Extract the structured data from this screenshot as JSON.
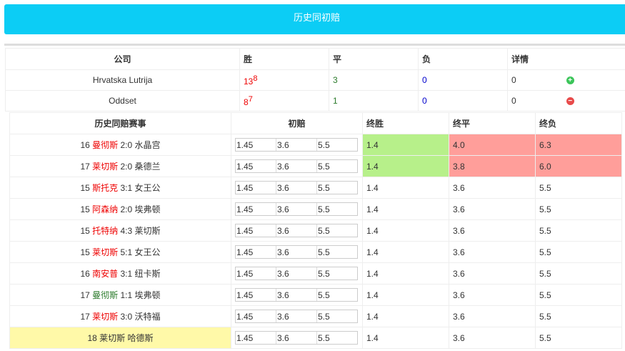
{
  "title": "历史同初赔",
  "companies": {
    "headers": [
      "公司",
      "胜",
      "平",
      "负",
      "详情"
    ],
    "rows": [
      {
        "name": "Hrvatska Lutrija",
        "win": "13",
        "win_sup": "8",
        "draw": "3",
        "loss": "0",
        "detail": "0",
        "icon": "plus-circle-icon",
        "icon_color": "#3cc55a"
      },
      {
        "name": "Oddset",
        "win": "8",
        "win_sup": "7",
        "draw": "1",
        "loss": "0",
        "detail": "0",
        "icon": "minus-circle-icon",
        "icon_color": "#e84a4a"
      }
    ]
  },
  "history": {
    "headers": [
      "历史同赔赛事",
      "初赔",
      "终胜",
      "终平",
      "终负"
    ],
    "rows": [
      {
        "season": "16",
        "home": "曼彻斯",
        "home_color": "red",
        "score": "2:0",
        "away": "水晶宫",
        "init": [
          "1.45",
          "3.6",
          "5.5"
        ],
        "final": [
          "1.4",
          "4.0",
          "6.3"
        ],
        "hl": [
          "g",
          "r",
          "r"
        ]
      },
      {
        "season": "17",
        "home": "莱切斯",
        "home_color": "red",
        "score": "2:0",
        "away": "桑德兰",
        "init": [
          "1.45",
          "3.6",
          "5.5"
        ],
        "final": [
          "1.4",
          "3.8",
          "6.0"
        ],
        "hl": [
          "g",
          "r",
          "r"
        ]
      },
      {
        "season": "15",
        "home": "斯托克",
        "home_color": "red",
        "score": "3:1",
        "away": "女王公",
        "init": [
          "1.45",
          "3.6",
          "5.5"
        ],
        "final": [
          "1.4",
          "3.6",
          "5.5"
        ],
        "hl": [
          "",
          "",
          ""
        ]
      },
      {
        "season": "15",
        "home": "阿森纳",
        "home_color": "red",
        "score": "2:0",
        "away": "埃弗顿",
        "init": [
          "1.45",
          "3.6",
          "5.5"
        ],
        "final": [
          "1.4",
          "3.6",
          "5.5"
        ],
        "hl": [
          "",
          "",
          ""
        ]
      },
      {
        "season": "15",
        "home": "托特纳",
        "home_color": "red",
        "score": "4:3",
        "away": "莱切斯",
        "init": [
          "1.45",
          "3.6",
          "5.5"
        ],
        "final": [
          "1.4",
          "3.6",
          "5.5"
        ],
        "hl": [
          "",
          "",
          ""
        ]
      },
      {
        "season": "15",
        "home": "莱切斯",
        "home_color": "red",
        "score": "5:1",
        "away": "女王公",
        "init": [
          "1.45",
          "3.6",
          "5.5"
        ],
        "final": [
          "1.4",
          "3.6",
          "5.5"
        ],
        "hl": [
          "",
          "",
          ""
        ]
      },
      {
        "season": "16",
        "home": "南安普",
        "home_color": "red",
        "score": "3:1",
        "away": "纽卡斯",
        "init": [
          "1.45",
          "3.6",
          "5.5"
        ],
        "final": [
          "1.4",
          "3.6",
          "5.5"
        ],
        "hl": [
          "",
          "",
          ""
        ]
      },
      {
        "season": "17",
        "home": "曼彻斯",
        "home_color": "green",
        "score": "1:1",
        "away": "埃弗顿",
        "init": [
          "1.45",
          "3.6",
          "5.5"
        ],
        "final": [
          "1.4",
          "3.6",
          "5.5"
        ],
        "hl": [
          "",
          "",
          ""
        ]
      },
      {
        "season": "17",
        "home": "莱切斯",
        "home_color": "red",
        "score": "3:0",
        "away": "沃特福",
        "init": [
          "1.45",
          "3.6",
          "5.5"
        ],
        "final": [
          "1.4",
          "3.6",
          "5.5"
        ],
        "hl": [
          "",
          "",
          ""
        ]
      },
      {
        "season": "18",
        "home": "莱切斯",
        "home_color": "plain",
        "score": "",
        "away": "哈德斯",
        "init": [
          "1.45",
          "3.6",
          "5.5"
        ],
        "final": [
          "1.4",
          "3.6",
          "5.5"
        ],
        "hl": [
          "",
          "",
          ""
        ],
        "current": true
      }
    ]
  }
}
